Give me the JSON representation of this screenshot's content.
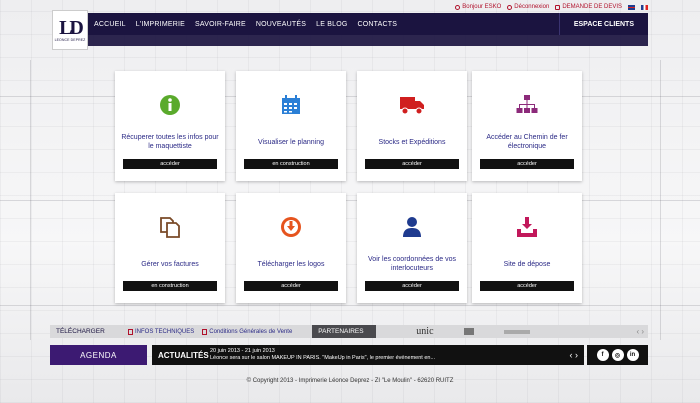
{
  "brand": {
    "logo_letters": "LD",
    "logo_sub": "LEONCE DEPREZ"
  },
  "top_bar": {
    "greeting": "Bonjour ESKO",
    "logout": "Déconnexion",
    "quote": "DEMANDE DE DEVIS",
    "flags": [
      "en-flag-icon",
      "fr-flag-icon"
    ]
  },
  "nav": {
    "items": [
      "ACCUEIL",
      "L'IMPRIMERIE",
      "SAVOIR-FAIRE",
      "NOUVEAUTÉS",
      "LE BLOG",
      "CONTACTS"
    ],
    "clients": "ESPACE CLIENTS"
  },
  "cards": [
    {
      "icon": "info-icon",
      "color": "#5aaa2c",
      "title": "Récuperer toutes les infos pour le maquettiste",
      "button": "accéder"
    },
    {
      "icon": "calendar-icon",
      "color": "#2a7fd6",
      "title": "Visualiser le planning",
      "button": "en construction"
    },
    {
      "icon": "truck-icon",
      "color": "#d01f1f",
      "title": "Stocks et Expéditions",
      "button": "accéder"
    },
    {
      "icon": "sitemap-icon",
      "color": "#8c2a7a",
      "title": "Accéder au Chemin de fer électronique",
      "button": "accéder"
    },
    {
      "icon": "documents-icon",
      "color": "#7a4a28",
      "title": "Gérer vos factures",
      "button": "en construction"
    },
    {
      "icon": "download-circle-icon",
      "color": "#e6541e",
      "title": "Télécharger les logos",
      "button": "accéder"
    },
    {
      "icon": "user-icon",
      "color": "#1f3b8f",
      "title": "Voir les coordonnées de vos interlocuteurs",
      "button": "accéder"
    },
    {
      "icon": "inbox-download-icon",
      "color": "#c2185b",
      "title": "Site de dépose",
      "button": "accéder"
    }
  ],
  "downloads": {
    "label": "TÉLÉCHARGER",
    "links": [
      "INFOS TECHNIQUES",
      "Conditions Générales de Vente"
    ]
  },
  "partners": {
    "label": "PARTENAIRES",
    "logo_text": "unic"
  },
  "agenda": {
    "label": "AGENDA"
  },
  "news": {
    "label": "ACTUALITÉS",
    "date": "20 juin 2013 - 21 juin 2013",
    "text": "Léonce sera sur le salon MAKEUP IN PARIS. \"MakeUp in Paris\", le premier événement en..."
  },
  "social": [
    "f",
    "◎",
    "in"
  ],
  "footer": {
    "copyright": "© Copyright 2013 - Imprimerie Léonce Deprez - ZI \"Le Moulin\" - 62620 RUITZ"
  }
}
